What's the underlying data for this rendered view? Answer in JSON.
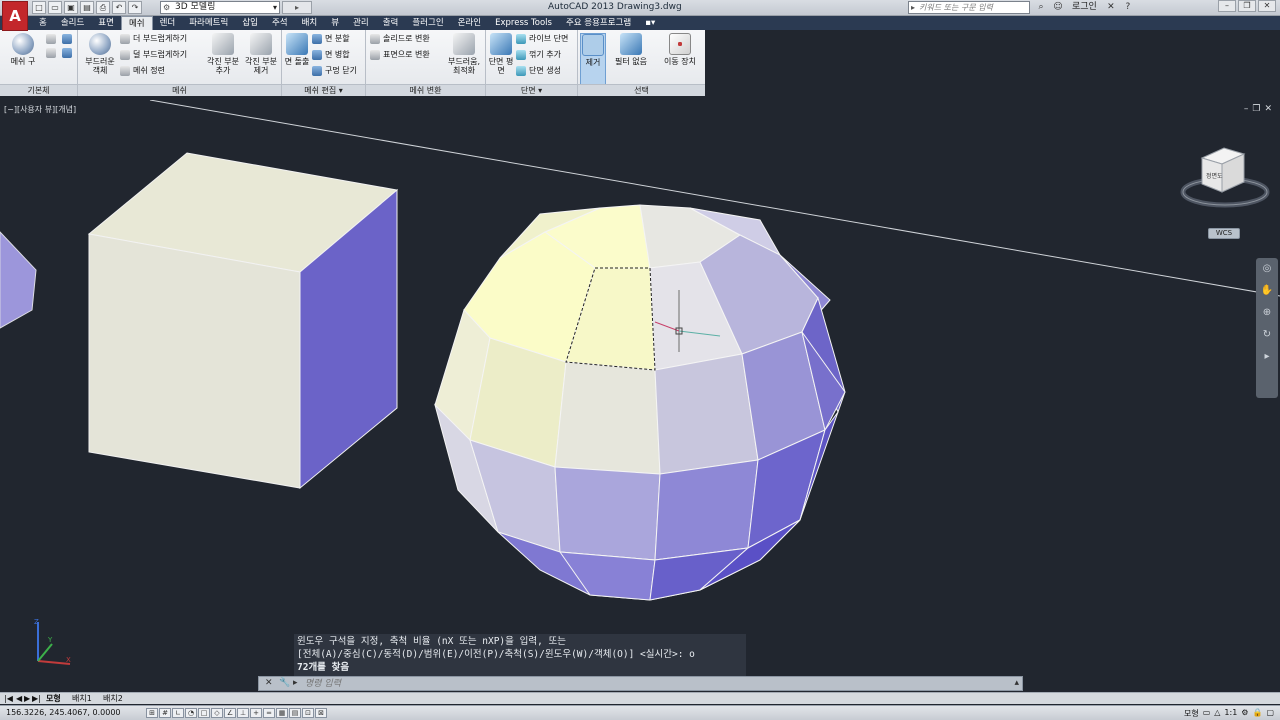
{
  "title_bar": {
    "logo": "A",
    "workspace": "3D 모델링",
    "app_title": "AutoCAD 2013    Drawing3.dwg",
    "search_placeholder": "키워드 또는 구문 입력",
    "login": "로그인",
    "qat_icons": [
      "new-icon",
      "open-icon",
      "save-icon",
      "saveas-icon",
      "print-icon",
      "undo-icon",
      "redo-icon"
    ]
  },
  "ribbon_tabs": [
    "홈",
    "솔리드",
    "표면",
    "메쉬",
    "렌더",
    "파라메트릭",
    "삽입",
    "주석",
    "배치",
    "뷰",
    "관리",
    "출력",
    "플러그인",
    "온라인",
    "Express Tools",
    "주요 응용프로그램"
  ],
  "active_tab": "메쉬",
  "ribbon": {
    "primitives": {
      "label": "기본체",
      "mesh_box": "메쉬 구"
    },
    "mesh": {
      "label": "메쉬",
      "smooth_object": "부드러운 객체",
      "smooth_more": "더 부드럽게하기",
      "smooth_less": "덜 부드럽게하기",
      "refine": "메쉬 정련"
    },
    "crease": {
      "add": "각진 부분 추가",
      "remove": "각진 부분 제거"
    },
    "mesh_edit": {
      "label": "메쉬 편집",
      "extrude": "면 돌출",
      "split": "면 분할",
      "merge": "면 병합",
      "close_hole": "구멍 닫기"
    },
    "convert": {
      "label": "메쉬 변환",
      "to_solid": "솔리드로 변환",
      "to_surface": "표면으로 변환",
      "smooth_optimized": "부드러움, 최적화"
    },
    "section": {
      "label": "단면",
      "section_plane": "단면 평면",
      "live_section": "라이브 단면",
      "add_jog": "꺾기 추가",
      "generate": "단면 생성"
    },
    "selection": {
      "label": "선택",
      "remove": "제거",
      "no_filter": "필터 없음",
      "move_gizmo": "이동 장치"
    }
  },
  "viewport": {
    "label": "[−][사용자 뷰][개념]",
    "wcs": "WCS",
    "viewcube_face": "정면도"
  },
  "command": {
    "history": [
      "윈도우 구석을 지정, 축척 비율 (nX 또는 nXP)을 입력, 또는",
      "[전체(A)/중심(C)/동적(D)/범위(E)/이전(P)/축척(S)/윈도우(W)/객체(O)] <실시간>: o",
      "72개를 찾음"
    ],
    "placeholder": "명령 입력"
  },
  "layout_tabs": [
    "모형",
    "배치1",
    "배치2"
  ],
  "status": {
    "coords": "156.3226, 245.4067, 0.0000",
    "model": "모형",
    "scale": "1:1"
  },
  "colors": {
    "ribbon_tab_bg": "#2b3a52",
    "viewport_bg": "#21262f",
    "face_light": "#e6e7d8",
    "face_blue": "#6b63c8",
    "selected_face": "#fbfcc8"
  }
}
